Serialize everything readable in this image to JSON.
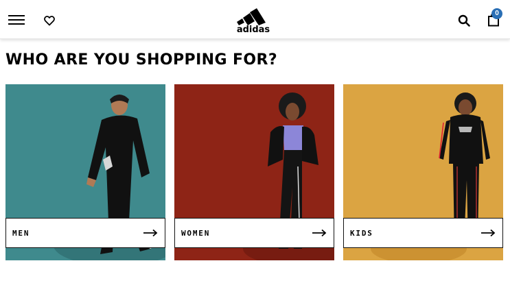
{
  "header": {
    "brand": "adidas",
    "bag_count": "0",
    "icons": {
      "menu": "hamburger-menu-icon",
      "wishlist": "heart-icon",
      "search": "search-icon",
      "bag": "shopping-bag-icon"
    }
  },
  "main": {
    "heading": "WHO ARE YOU SHOPPING FOR?",
    "cards": [
      {
        "label": "MEN",
        "arrow": "arrow-right-icon",
        "background": "#3f8a8d"
      },
      {
        "label": "WOMEN",
        "arrow": "arrow-right-icon",
        "background": "#8e2416"
      },
      {
        "label": "KIDS",
        "arrow": "arrow-right-icon",
        "background": "#dba442"
      }
    ]
  },
  "colors": {
    "badge": "#2a6fb5",
    "text": "#000000"
  }
}
